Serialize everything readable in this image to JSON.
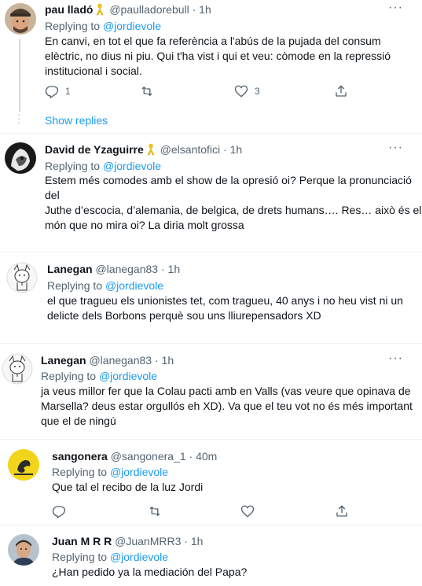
{
  "tweets": [
    {
      "name": "pau lladó",
      "handle": "@paulladorebull",
      "time": "· 1h",
      "reply_prefix": "Replying to",
      "reply_mention": "@jordievole",
      "text_lines": [
        "En canvi, en tot el que fa referència a l'abús de la pujada del consum",
        "elèctric, no dius ni piu. Qui t'ha vist i qui et veu: còmode en la repressió",
        "institucional i social."
      ],
      "reply_count": "1",
      "retweet_count": "",
      "like_count": "3",
      "show_replies": "Show replies"
    },
    {
      "name": "David de Yzaguirre",
      "handle": "@elsantofici",
      "time": "· 1h",
      "reply_prefix": "Replying to",
      "reply_mention": "@jordievole",
      "text_lines": [
        "Estem més comodes amb el show de la opresió oi? Perque la pronunciació",
        "del",
        "Juthe d’escocia, d’alemania, de belgica, de drets humans…. Res… això és el",
        "món que no mira oi?  La diria molt grossa"
      ]
    },
    {
      "name": "Lanegan",
      "handle": "@lanegan83",
      "time": "· 1h",
      "reply_prefix": "Replying to",
      "reply_mention": "@jordievole",
      "text_lines": [
        "el que tragueu els unionistes tet, com tragueu, 40 anys i no heu vist ni un",
        "delicte dels Borbons perquè sou uns lliurepensadors XD"
      ]
    },
    {
      "name": "Lanegan",
      "handle": "@lanegan83",
      "time": "· 1h",
      "reply_prefix": "Replying to",
      "reply_mention": "@jordievole",
      "text_lines": [
        "ja veus millor fer que la Colau pacti amb en Valls (vas veure que opinava de",
        "Marsella? deus estar orgullós eh XD). Va que el teu vot no és més important",
        "que el de ningú"
      ]
    },
    {
      "name": "sangonera",
      "handle": "@sangonera_1",
      "time": "· 40m",
      "reply_prefix": "Replying to",
      "reply_mention": "@jordievole",
      "text_lines": [
        "Que tal el recibo de la luz Jordi"
      ]
    },
    {
      "name": "Juan M R R",
      "handle": "@JuanMRR3",
      "time": "· 1h",
      "reply_prefix": "Replying to",
      "reply_mention": "@jordievole",
      "text_lines": [
        "¿Han pedido ya la mediación del Papa?"
      ]
    }
  ],
  "icons": {
    "ribbon": "yellow-ribbon-icon",
    "reply": "reply-icon",
    "retweet": "retweet-icon",
    "like": "heart-icon",
    "share": "share-icon",
    "more": "more-dots-icon"
  },
  "colors": {
    "accent": "#1d9bf0",
    "secondary_text": "#536471",
    "ribbon": "#f5c518",
    "divider": "#eff3f4"
  }
}
